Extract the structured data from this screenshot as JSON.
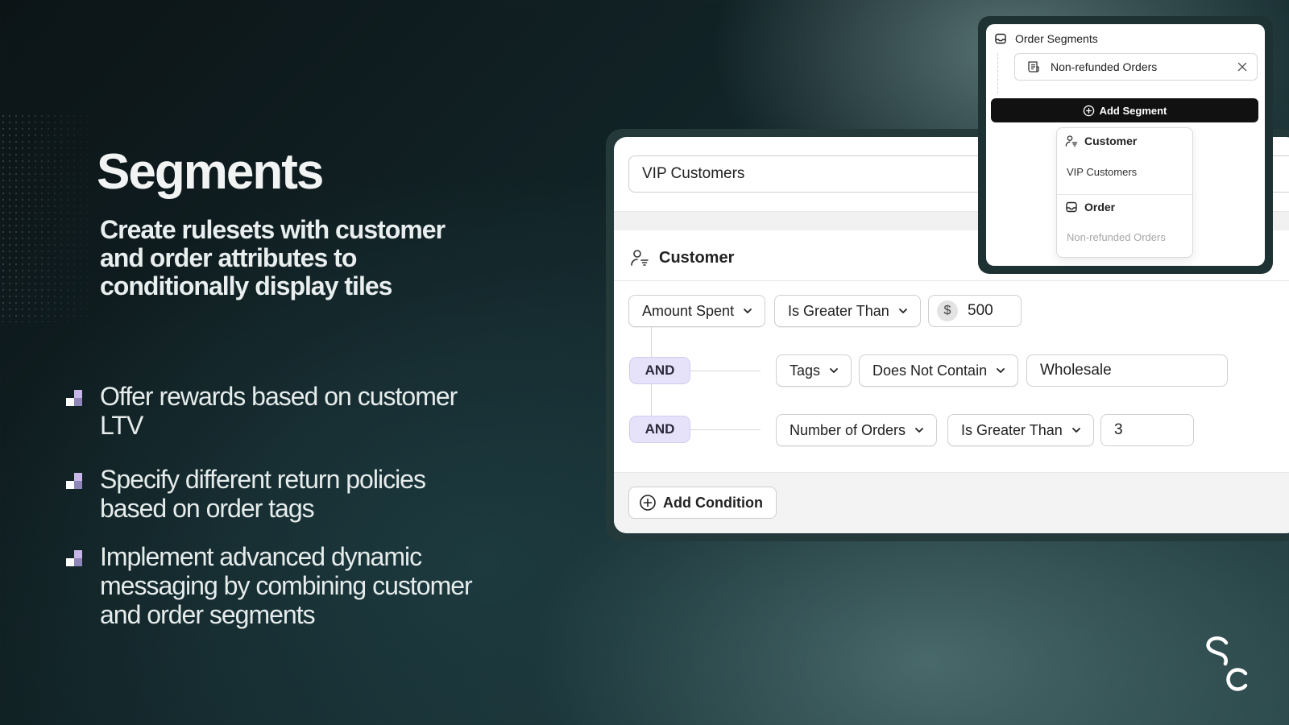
{
  "hero": {
    "title": "Segments",
    "subtitle": "Create rulesets with customer and order attributes to conditionally display tiles"
  },
  "bullets": [
    "Offer rewards based on customer LTV",
    "Specify different return policies based on order tags",
    "Implement advanced dynamic messaging by combining customer and order segments"
  ],
  "segment_editor": {
    "name_value": "VIP Customers",
    "section_title": "Customer",
    "conditions": [
      {
        "attribute": "Amount Spent",
        "operator": "Is Greater Than",
        "currency": "$",
        "value": "500"
      },
      {
        "connector": "AND",
        "attribute": "Tags",
        "operator": "Does Not Contain",
        "value": "Wholesale"
      },
      {
        "connector": "AND",
        "attribute": "Number of Orders",
        "operator": "Is Greater Than",
        "value": "3"
      }
    ],
    "add_condition_label": "Add Condition"
  },
  "order_segments_popup": {
    "title": "Order Segments",
    "selected_segment": "Non-refunded Orders",
    "add_segment_label": "Add Segment",
    "dropdown": {
      "groups": [
        {
          "heading": "Customer",
          "items": [
            "VIP Customers"
          ]
        },
        {
          "heading": "Order",
          "items": [
            "Non-refunded Orders"
          ]
        }
      ]
    }
  },
  "brand": {
    "logo_letters": "SC"
  },
  "colors": {
    "and_badge": "#e6e2fa",
    "add_segment_bg": "#111111",
    "bullet_light": "#c7b6e8",
    "bullet_dark": "#8f86b8"
  }
}
